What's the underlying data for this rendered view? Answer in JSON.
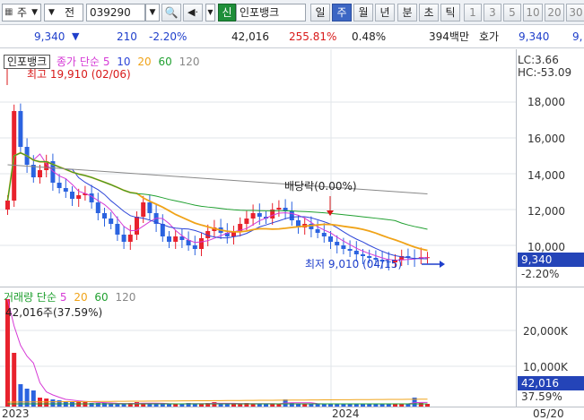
{
  "toolbar": {
    "market": "주",
    "type": "전",
    "code": "039290",
    "badge": "신",
    "name": "인포뱅크",
    "periods": [
      "일",
      "주",
      "월",
      "년",
      "분",
      "초",
      "틱"
    ],
    "active_period": "주",
    "numbers": [
      "1",
      "3",
      "5",
      "10",
      "20",
      "30"
    ]
  },
  "quote": {
    "price": "9,340",
    "change": "210",
    "change_pct": "-2.20%",
    "volume": "42,016",
    "vol_ratio": "255.81%",
    "turnover": "0.48%",
    "amount": "394백만",
    "ask_label": "호가",
    "ask_price": "9,340",
    "ask_price2": "9,"
  },
  "price_pane": {
    "stock_tag": "인포뱅크",
    "legend_title": "종가 단순",
    "ma": [
      {
        "label": "5",
        "color": "#d63ad6"
      },
      {
        "label": "10",
        "color": "#2d45d8"
      },
      {
        "label": "20",
        "color": "#f0a318"
      },
      {
        "label": "60",
        "color": "#20a030"
      },
      {
        "label": "120",
        "color": "#888888"
      }
    ],
    "high_note": "최고 19,910 (02/06)",
    "low_note": "최저 9,010 (04/15)",
    "dividend_note": "배당락(0.00%)",
    "lc": "LC:3.66",
    "hc": "HC:-53.09",
    "y_ticks": [
      "18,000",
      "16,000",
      "14,000",
      "12,000",
      "10,000"
    ],
    "current_price": "9,340",
    "current_pct": "-2.20%"
  },
  "volume_pane": {
    "legend_title": "거래량 단순",
    "ma": [
      {
        "label": "5",
        "color": "#d63ad6"
      },
      {
        "label": "20",
        "color": "#f0a318"
      },
      {
        "label": "60",
        "color": "#20a030"
      },
      {
        "label": "120",
        "color": "#888888"
      }
    ],
    "max_note": "42,016주(37.59%)",
    "y_ticks": [
      "20,000K",
      "10,000K"
    ],
    "current_volume": "42,016",
    "current_pct": "37.59%"
  },
  "x_axis": {
    "labels": [
      "2023",
      "2024",
      "05/20"
    ]
  },
  "colors": {
    "up": "#e8222d",
    "down": "#2b63e0",
    "select_blue": "#2444b8"
  }
}
